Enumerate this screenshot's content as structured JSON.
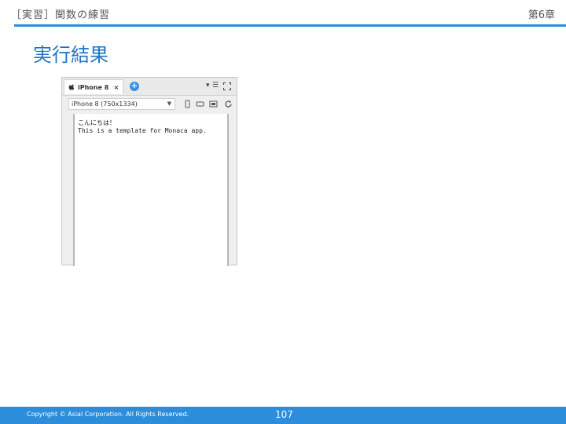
{
  "header": {
    "section": "［実習］関数の練習",
    "chapter": "第6章"
  },
  "slide": {
    "title": "実行結果"
  },
  "simulator": {
    "tab_label": "iPhone 8",
    "tab_close": "×",
    "device_select": "iPhone 8 (750x1334)",
    "screen_lines": [
      "こんにちは！",
      "This is a template for Monaca app."
    ]
  },
  "footer": {
    "copyright": "Copyright © Asial Corporation. All Rights Reserved.",
    "page_number": "107"
  },
  "colors": {
    "accent": "#2b8ddb",
    "title": "#1f73c4"
  }
}
